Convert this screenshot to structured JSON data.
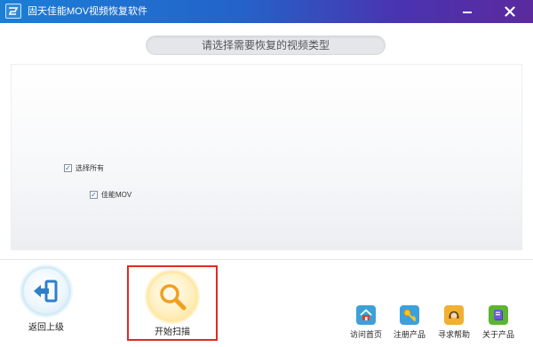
{
  "window": {
    "title": "固天佳能MOV视频恢复软件"
  },
  "header": {
    "prompt": "请选择需要恢复的视频类型"
  },
  "options": {
    "select_all": {
      "label": "选择所有",
      "checked": true
    },
    "canon_mov": {
      "label": "佳能MOV",
      "checked": true
    }
  },
  "actions": {
    "back": {
      "label": "返回上级",
      "icon": "exit-door-icon"
    },
    "scan": {
      "label": "开始扫描",
      "icon": "magnifier-icon"
    }
  },
  "links": {
    "home": {
      "label": "访问首页",
      "icon": "home-icon"
    },
    "register": {
      "label": "注册产品",
      "icon": "key-icon"
    },
    "help": {
      "label": "寻求帮助",
      "icon": "support-headset-icon"
    },
    "about": {
      "label": "关于产品",
      "icon": "info-book-icon"
    }
  },
  "colors": {
    "titlebar_start": "#1b7fd6",
    "titlebar_end": "#5b2a9e",
    "highlight_border": "#e02a24"
  }
}
